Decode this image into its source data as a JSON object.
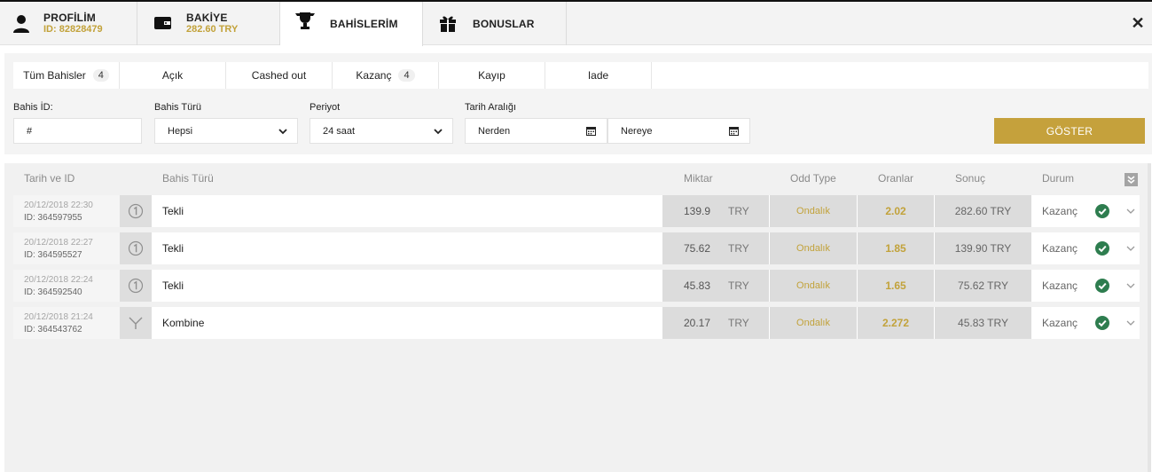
{
  "header": {
    "tabs": [
      {
        "title": "PROFİLİM",
        "sub": "ID: 82828479",
        "icon": "user-icon"
      },
      {
        "title": "BAKİYE",
        "sub": "282.60 TRY",
        "icon": "wallet-icon"
      },
      {
        "title": "BAHİSLERİM",
        "sub": "",
        "icon": "trophy-icon"
      },
      {
        "title": "BONUSLAR",
        "sub": "",
        "icon": "gift-icon"
      }
    ],
    "close": "✕"
  },
  "filters": {
    "tabs": [
      {
        "label": "Tüm Bahisler",
        "count": "4"
      },
      {
        "label": "Açık",
        "count": ""
      },
      {
        "label": "Cashed out",
        "count": ""
      },
      {
        "label": "Kazanç",
        "count": "4"
      },
      {
        "label": "Kayıp",
        "count": ""
      },
      {
        "label": "Iade",
        "count": ""
      }
    ],
    "labels": {
      "bet_id": "Bahis İD:",
      "bet_type": "Bahis Türü",
      "period": "Periyot",
      "date_range": "Tarih Aralığı"
    },
    "bet_id_placeholder": "#",
    "bet_type_value": "Hepsi",
    "period_value": "24 saat",
    "from_value": "Nerden",
    "to_value": "Nereye",
    "show_button": "GÖSTER"
  },
  "table": {
    "headers": {
      "date_id": "Tarih ve ID",
      "bet_type": "Bahis Türü",
      "amount": "Miktar",
      "odd_type": "Odd Type",
      "rates": "Oranlar",
      "result": "Sonuç",
      "status": "Durum"
    },
    "rows": [
      {
        "date": "20/12/2018 22:30",
        "id": "ID: 364597955",
        "type_icon": "single-bet-icon",
        "type": "Tekli",
        "amount": "139.9",
        "currency": "TRY",
        "odd_type": "Ondalık",
        "rate": "2.02",
        "result": "282.60 TRY",
        "status": "Kazanç"
      },
      {
        "date": "20/12/2018 22:27",
        "id": "ID: 364595527",
        "type_icon": "single-bet-icon",
        "type": "Tekli",
        "amount": "75.62",
        "currency": "TRY",
        "odd_type": "Ondalık",
        "rate": "1.85",
        "result": "139.90 TRY",
        "status": "Kazanç"
      },
      {
        "date": "20/12/2018 22:24",
        "id": "ID: 364592540",
        "type_icon": "single-bet-icon",
        "type": "Tekli",
        "amount": "45.83",
        "currency": "TRY",
        "odd_type": "Ondalık",
        "rate": "1.65",
        "result": "75.62 TRY",
        "status": "Kazanç"
      },
      {
        "date": "20/12/2018 21:24",
        "id": "ID: 364543762",
        "type_icon": "combo-bet-icon",
        "type": "Kombine",
        "amount": "20.17",
        "currency": "TRY",
        "odd_type": "Ondalık",
        "rate": "2.272",
        "result": "45.83 TRY",
        "status": "Kazanç"
      }
    ]
  },
  "colors": {
    "accent": "#c5a13c",
    "success": "#2e7d4f"
  }
}
